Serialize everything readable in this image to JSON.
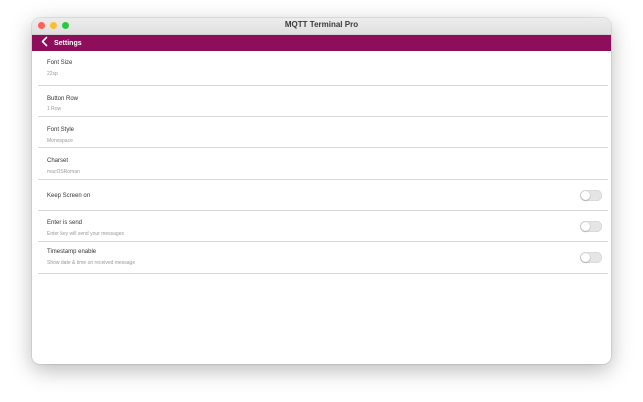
{
  "window": {
    "title": "MQTT Terminal Pro"
  },
  "appbar": {
    "title": "Settings",
    "accent_color": "#8e0e5c",
    "back_icon": "chevron-left-icon"
  },
  "settings": [
    {
      "label": "Font Size",
      "value": "22sp"
    },
    {
      "label": "Button Row",
      "value": "1 Row"
    },
    {
      "label": "Font Style",
      "value": "Monospace"
    },
    {
      "label": "Charset",
      "value": "macOSRoman"
    },
    {
      "label": "Keep Screen on",
      "enabled": false
    },
    {
      "label": "Enter is send",
      "value": "Enter key will send your messages",
      "enabled": false
    },
    {
      "label": "Timestamp enable",
      "value": "Show date & time on received message",
      "enabled": false
    }
  ]
}
